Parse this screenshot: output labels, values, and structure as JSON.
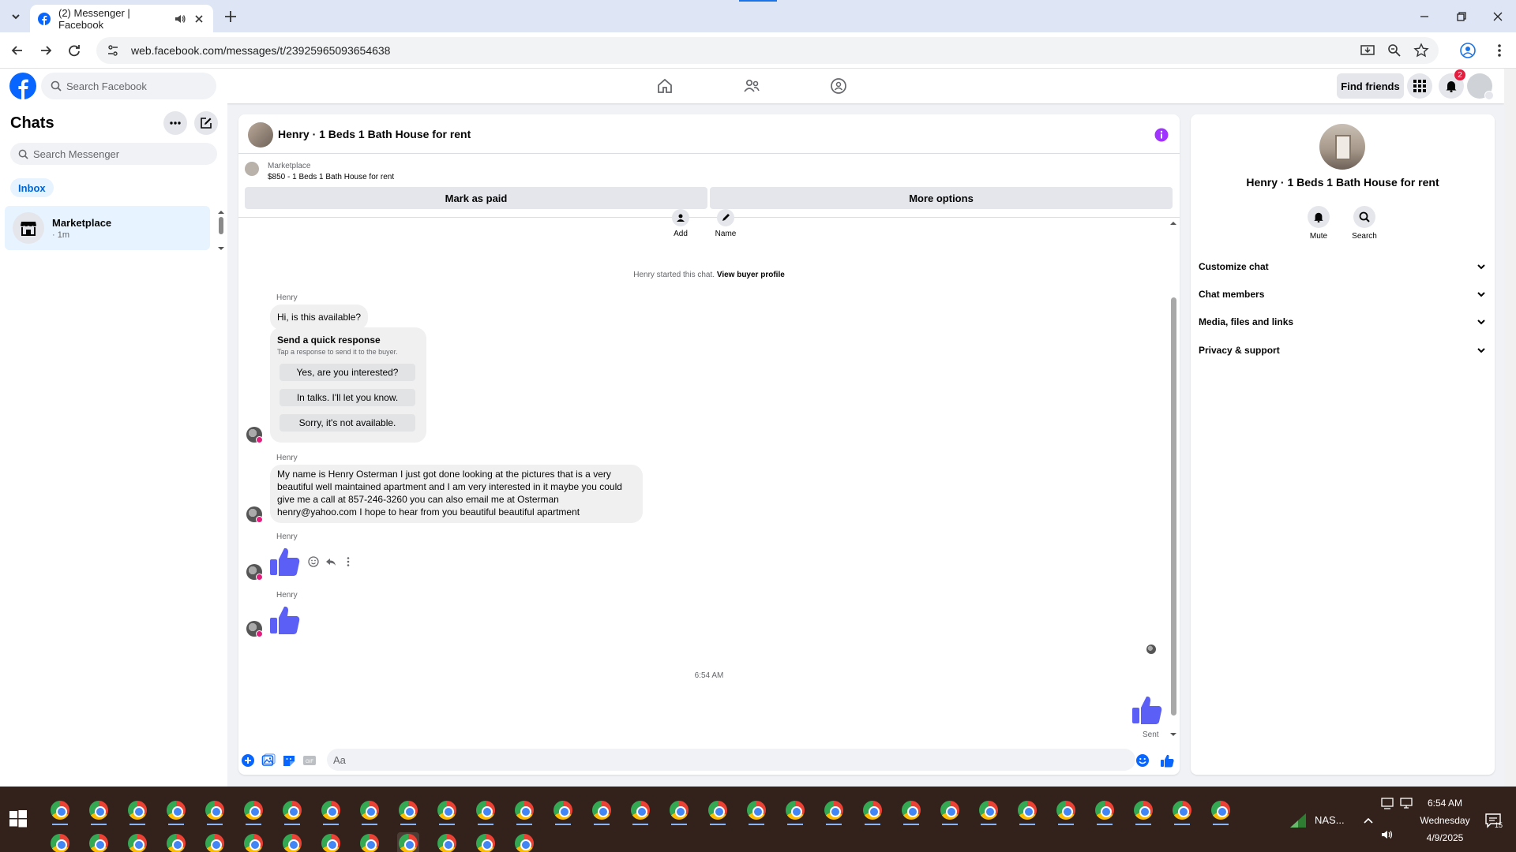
{
  "browser": {
    "tab_title": "(2) Messenger | Facebook",
    "url": "web.facebook.com/messages/t/23925965093654638",
    "accent_color": "#1a73e8"
  },
  "fbnav": {
    "search_placeholder": "Search Facebook",
    "find_friends_label": "Find friends",
    "notification_count": "2",
    "brand_color": "#0866ff"
  },
  "sidebar": {
    "title": "Chats",
    "search_placeholder": "Search Messenger",
    "filter_label": "Inbox",
    "conversations": [
      {
        "name": "Marketplace",
        "time": "· 1m",
        "icon": "marketplace-store-icon"
      }
    ]
  },
  "chat": {
    "title": "Henry · 1 Beds 1 Bath House for rent",
    "marketplace_label": "Marketplace",
    "listing_line": "$850 - 1 Beds 1 Bath House for rent",
    "mark_paid_label": "Mark as paid",
    "more_options_label": "More options",
    "top_actions": [
      {
        "label": "Add",
        "icon": "add-person-icon"
      },
      {
        "label": "Name",
        "icon": "pencil-icon"
      }
    ],
    "system_text": "Henry started this chat.",
    "system_link": "View buyer profile",
    "messages": [
      {
        "sender": "Henry",
        "text": "Hi, is this available?"
      },
      {
        "sender": "Henry",
        "text": "My name is Henry Osterman I just got done looking at the pictures that is a very beautiful well maintained apartment and I am very interested in it maybe you could give me a call at 857-246-3260 you can also email me at Osterman henry@yahoo.com I hope to hear from you beautiful beautiful apartment"
      },
      {
        "sender": "Henry",
        "text": ""
      },
      {
        "sender": "Henry",
        "text": ""
      }
    ],
    "quick_response": {
      "title": "Send a quick response",
      "subtitle": "Tap a response to send it to the buyer.",
      "options": [
        "Yes, are you interested?",
        "In talks. I'll let you know.",
        "Sorry, it's not available."
      ]
    },
    "time_separator": "6:54 AM",
    "sent_status": "Sent",
    "composer_placeholder": "Aa",
    "like_color": "#5b5ff5"
  },
  "info_panel": {
    "name": "Henry · 1 Beds 1 Bath House for rent",
    "actions": [
      {
        "label": "Mute",
        "icon": "bell-icon"
      },
      {
        "label": "Search",
        "icon": "search-icon"
      }
    ],
    "sections": [
      "Customize chat",
      "Chat members",
      "Media, files and links",
      "Privacy & support"
    ]
  },
  "taskbar": {
    "network_label": "NAS...",
    "time": "6:54 AM",
    "day": "Wednesday",
    "date": "4/9/2025",
    "notification_count": "15"
  }
}
